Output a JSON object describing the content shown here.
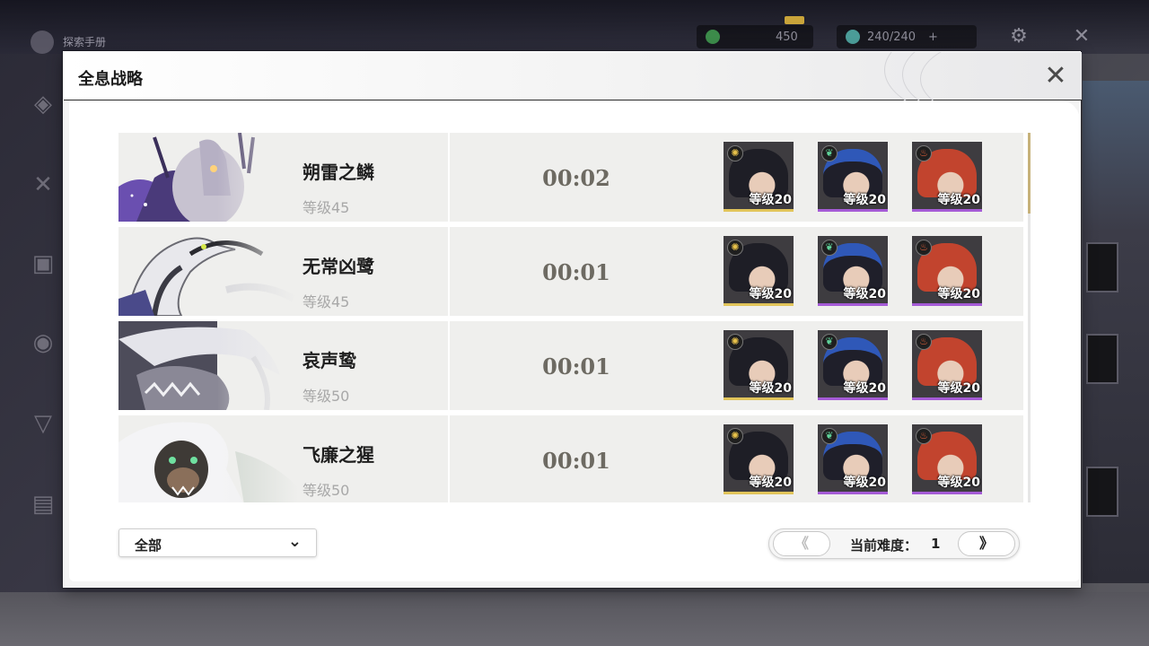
{
  "background": {
    "home_label": "探索手册",
    "currency_value": "450",
    "stamina_value": "240/240",
    "stamina_plus": "+"
  },
  "dialog": {
    "title": "全息战略",
    "close_label": "✕"
  },
  "rows": [
    {
      "boss_name": "朔雷之鳞",
      "boss_level": "等级45",
      "time": "00:02",
      "team": [
        {
          "level": "等级20",
          "element": "spectro",
          "rarity": "gold"
        },
        {
          "level": "等级20",
          "element": "aero",
          "rarity": "purple"
        },
        {
          "level": "等级20",
          "element": "fusion",
          "rarity": "purple"
        }
      ]
    },
    {
      "boss_name": "无常凶鹭",
      "boss_level": "等级45",
      "time": "00:01",
      "team": [
        {
          "level": "等级20",
          "element": "spectro",
          "rarity": "gold"
        },
        {
          "level": "等级20",
          "element": "aero",
          "rarity": "purple"
        },
        {
          "level": "等级20",
          "element": "fusion",
          "rarity": "purple"
        }
      ]
    },
    {
      "boss_name": "哀声鸷",
      "boss_level": "等级50",
      "time": "00:01",
      "team": [
        {
          "level": "等级20",
          "element": "spectro",
          "rarity": "gold"
        },
        {
          "level": "等级20",
          "element": "aero",
          "rarity": "purple"
        },
        {
          "level": "等级20",
          "element": "fusion",
          "rarity": "purple"
        }
      ]
    },
    {
      "boss_name": "飞廉之猩",
      "boss_level": "等级50",
      "time": "00:01",
      "team": [
        {
          "level": "等级20",
          "element": "spectro",
          "rarity": "gold"
        },
        {
          "level": "等级20",
          "element": "aero",
          "rarity": "purple"
        },
        {
          "level": "等级20",
          "element": "fusion",
          "rarity": "purple"
        }
      ]
    }
  ],
  "filter": {
    "selected": "全部",
    "chevron": "⌄"
  },
  "pager": {
    "prev_label": "《",
    "label": "当前难度：",
    "value": "1",
    "next_label": "》"
  },
  "colors": {
    "gold_rarity": "#e1c45a",
    "purple_rarity": "#a55bd6",
    "time_text": "#6d6a62"
  }
}
